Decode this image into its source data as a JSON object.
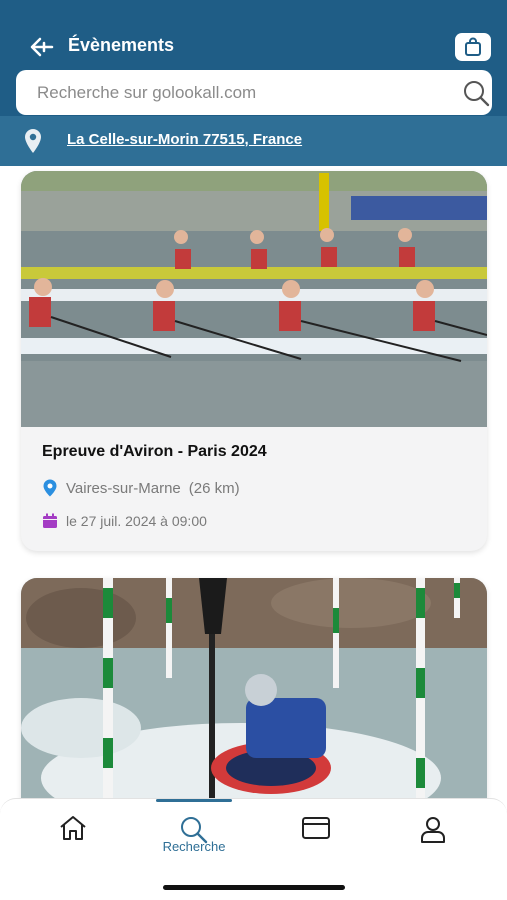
{
  "header": {
    "title": "Évènements",
    "search_placeholder": "Recherche sur golookall.com",
    "location": "La Celle-sur-Morin 77515, France"
  },
  "events": [
    {
      "title": "Epreuve d'Aviron - Paris 2024",
      "place": "Vaires-sur-Marne",
      "distance": "(26 km)",
      "date": "le 27 juil. 2024 à 09:00"
    }
  ],
  "tabs": {
    "active_label": "Recherche",
    "items": [
      "home-icon",
      "search-icon",
      "browser-icon",
      "profile-icon"
    ]
  },
  "colors": {
    "primary": "#1f5d86",
    "accent": "#2f6f96",
    "pin": "#2b8fe0",
    "calendar": "#a43cc4"
  }
}
